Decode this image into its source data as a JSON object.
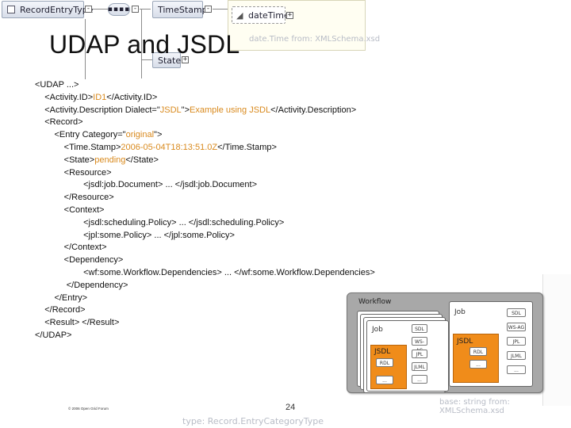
{
  "schema": {
    "record_entry_type": "RecordEntryType",
    "time_stamp": "TimeStamp",
    "date_time": "dateTime",
    "date_time_type": "date.Time from: XMLSchema.xsd",
    "state": "State",
    "base_string": "base: string from: XMLSchema.xsd",
    "type_record": "type: Record.EntryCategoryType"
  },
  "slide": {
    "title": "UDAP and JSDL",
    "footer": "© 2006 Open Grid Forum",
    "page_number": "24"
  },
  "code": [
    {
      "parts": [
        {
          "t": "<UDAP ...>"
        }
      ]
    },
    {
      "parts": [
        {
          "t": "    <Activity.ID>"
        },
        {
          "t": "ID1",
          "v": true
        },
        {
          "t": "</Activity.ID>"
        }
      ]
    },
    {
      "parts": [
        {
          "t": "    <Activity.Description Dialect=\""
        },
        {
          "t": "JSDL",
          "v": true
        },
        {
          "t": "\">"
        },
        {
          "t": "Example using JSDL",
          "v": true
        },
        {
          "t": "</Activity.Description>"
        }
      ]
    },
    {
      "parts": [
        {
          "t": "    <Record>"
        }
      ]
    },
    {
      "parts": [
        {
          "t": "        <Entry Category=\""
        },
        {
          "t": "original",
          "v": true
        },
        {
          "t": "\">"
        }
      ]
    },
    {
      "parts": [
        {
          "t": "            <Time.Stamp>"
        },
        {
          "t": "2006-05-04T18:13:51.0Z",
          "v": true
        },
        {
          "t": "</Time.Stamp>"
        }
      ]
    },
    {
      "parts": [
        {
          "t": "            <State>"
        },
        {
          "t": "pending",
          "v": true
        },
        {
          "t": "</State>"
        }
      ]
    },
    {
      "parts": [
        {
          "t": "            <Resource>"
        }
      ]
    },
    {
      "parts": [
        {
          "t": "                    <jsdl:job.Document> ... </jsdl:job.Document>"
        }
      ]
    },
    {
      "parts": [
        {
          "t": "            </Resource>"
        }
      ]
    },
    {
      "parts": [
        {
          "t": "            <Context>"
        }
      ]
    },
    {
      "parts": [
        {
          "t": "                    <jsdl:scheduling.Policy> ... </jsdl:scheduling.Policy>"
        }
      ]
    },
    {
      "parts": [
        {
          "t": "                    <jpl:some.Policy> ... </jpl:some.Policy>"
        }
      ]
    },
    {
      "parts": [
        {
          "t": "            </Context>"
        }
      ]
    },
    {
      "parts": [
        {
          "t": "            <Dependency>"
        }
      ]
    },
    {
      "parts": [
        {
          "t": "                    <wf:some.Workflow.Dependencies> ... </wf:some.Workflow.Dependencies>"
        }
      ]
    },
    {
      "parts": [
        {
          "t": "             </Dependency>"
        }
      ]
    },
    {
      "parts": [
        {
          "t": "        </Entry>"
        }
      ]
    },
    {
      "parts": [
        {
          "t": "    </Record>"
        }
      ]
    },
    {
      "parts": [
        {
          "t": "    <Result> </Result>"
        }
      ]
    },
    {
      "parts": [
        {
          "t": "</UDAP>"
        }
      ]
    }
  ],
  "diagram": {
    "workflow_label": "Workflow",
    "job_label": "Job",
    "jsdl_label": "JSDL",
    "chips_left": [
      "SDL",
      "WS-AG",
      "JPL",
      "JLML",
      "..."
    ],
    "chips_right": [
      "SDL",
      "WS-AG",
      "JPL",
      "JLML",
      "..."
    ],
    "rdl_label": "RDL",
    "ellipsis": "...",
    "colors": {
      "jsdl": "#f08c1a",
      "panel": "#a8a8a8"
    }
  }
}
